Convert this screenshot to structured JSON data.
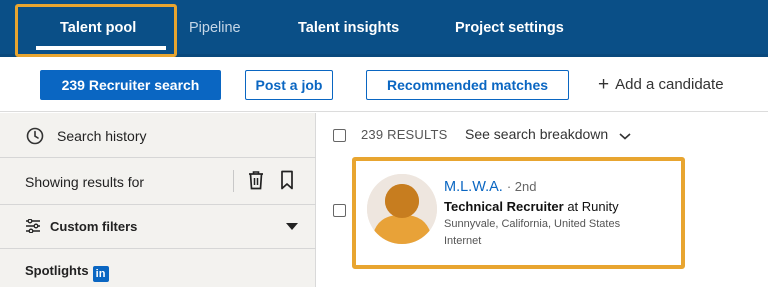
{
  "colors": {
    "nav_bg": "#0a4f87",
    "primary": "#0a66c2",
    "highlight": "#e8a530",
    "sidebar_bg": "#f3f2ef"
  },
  "nav": {
    "tabs": [
      {
        "label": "Talent pool",
        "active": true
      },
      {
        "label": "Pipeline",
        "active": false
      },
      {
        "label": "Talent insights",
        "active": false
      },
      {
        "label": "Project settings",
        "active": false
      }
    ]
  },
  "actions": {
    "recruiter_search": "239 Recruiter search",
    "post_job": "Post a job",
    "recommended": "Recommended matches",
    "add_candidate": "Add a candidate"
  },
  "sidebar": {
    "search_history": "Search history",
    "showing_results": "Showing results for",
    "custom_filters": "Custom filters",
    "spotlights": "Spotlights",
    "spotlights_badge": "in"
  },
  "results": {
    "count": "239 RESULTS",
    "breakdown": "See search breakdown"
  },
  "candidate": {
    "name": "M.L.W.A.",
    "degree": "· 2nd",
    "title": "Technical Recruiter",
    "company": "at Runity",
    "location": "Sunnyvale, California, United States",
    "industry": "Internet"
  },
  "icons": [
    "clock-icon",
    "trash-icon",
    "bookmark-icon",
    "filter-icon",
    "chevron-down-icon",
    "plus-icon",
    "avatar"
  ]
}
